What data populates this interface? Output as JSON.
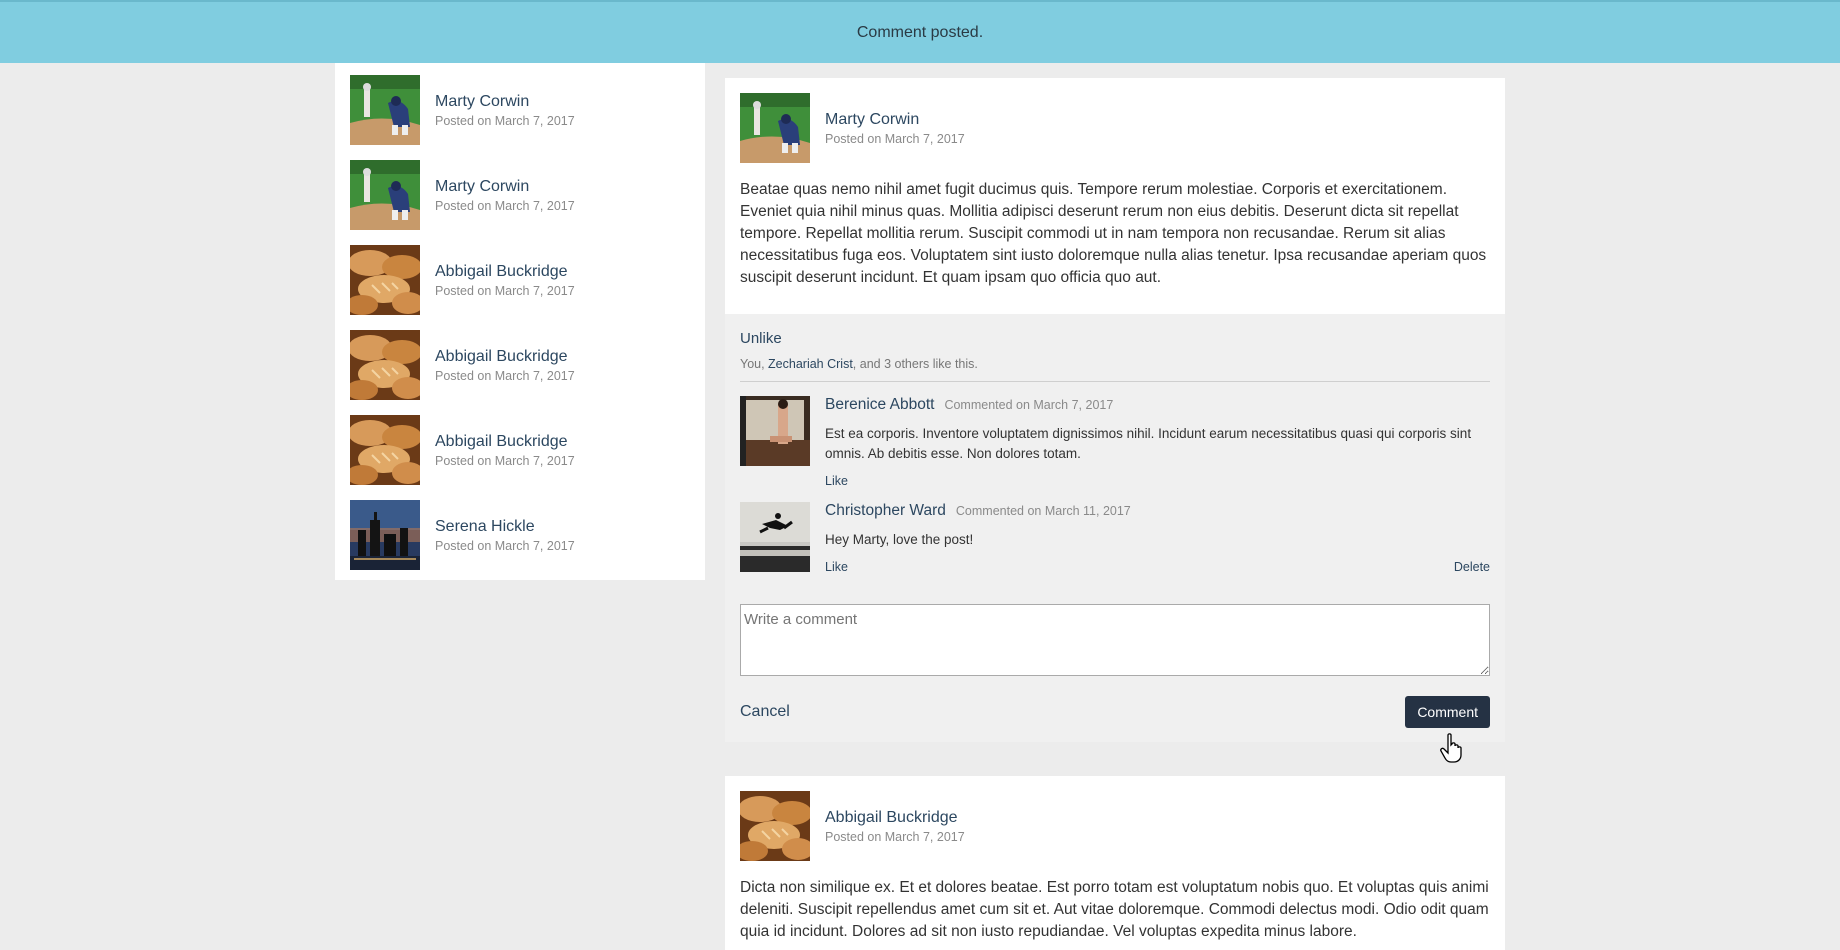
{
  "flash": {
    "message": "Comment posted."
  },
  "sidebar": {
    "items": [
      {
        "name": "Marty Corwin",
        "posted": "Posted on March 7, 2017",
        "image": "baseball-photo"
      },
      {
        "name": "Marty Corwin",
        "posted": "Posted on March 7, 2017",
        "image": "baseball-photo"
      },
      {
        "name": "Abbigail Buckridge",
        "posted": "Posted on March 7, 2017",
        "image": "bread-photo"
      },
      {
        "name": "Abbigail Buckridge",
        "posted": "Posted on March 7, 2017",
        "image": "bread-photo"
      },
      {
        "name": "Abbigail Buckridge",
        "posted": "Posted on March 7, 2017",
        "image": "bread-photo"
      },
      {
        "name": "Serena Hickle",
        "posted": "Posted on March 7, 2017",
        "image": "city-skyline-photo"
      }
    ]
  },
  "post1": {
    "author": "Marty Corwin",
    "posted": "Posted on March 7, 2017",
    "body": "Beatae quas nemo nihil amet fugit ducimus quis. Tempore rerum molestiae. Corporis et exercitationem. Eveniet quia nihil minus quas. Mollitia adipisci deserunt rerum non eius debitis. Deserunt dicta sit repellat tempore. Repellat mollitia rerum. Suscipit commodi ut in nam tempora non recusandae. Rerum sit alias necessitatibus fuga eos. Voluptatem sint iusto doloremque nulla alias tenetur. Ipsa recusandae aperiam quos suscipit deserunt incidunt. Et quam ipsam quo officia quo aut.",
    "unlike_label": "Unlike",
    "likes": {
      "prefix": "You, ",
      "person": "Zechariah Crist",
      "suffix": ", and 3 others like this."
    },
    "comments": [
      {
        "author": "Berenice Abbott",
        "date": "Commented on March 7, 2017",
        "text": "Est ea corporis. Inventore voluptatem dignissimos nihil. Incidunt earum necessitatibus quasi qui corporis sint omnis. Ab debitis esse. Non dolores totam.",
        "like_label": "Like"
      },
      {
        "author": "Christopher Ward",
        "date": "Commented on March 11, 2017",
        "text": "Hey Marty, love the post!",
        "like_label": "Like",
        "delete_label": "Delete"
      }
    ],
    "comment_placeholder": "Write a comment",
    "cancel_label": "Cancel",
    "submit_label": "Comment"
  },
  "post2": {
    "author": "Abbigail Buckridge",
    "posted": "Posted on March 7, 2017",
    "body": "Dicta non similique ex. Et et dolores beatae. Est porro totam est voluptatum nobis quo. Et voluptas quis animi deleniti. Suscipit repellendus amet cum sit et. Aut vitae doloremque. Commodi delectus modi. Odio odit quam quia id incidunt. Dolores ad sit non iusto repudiandae. Vel voluptas expedita minus labore."
  },
  "colors": {
    "flash_bg": "#80cde0",
    "link": "#2c4760",
    "button_bg": "#253244"
  }
}
